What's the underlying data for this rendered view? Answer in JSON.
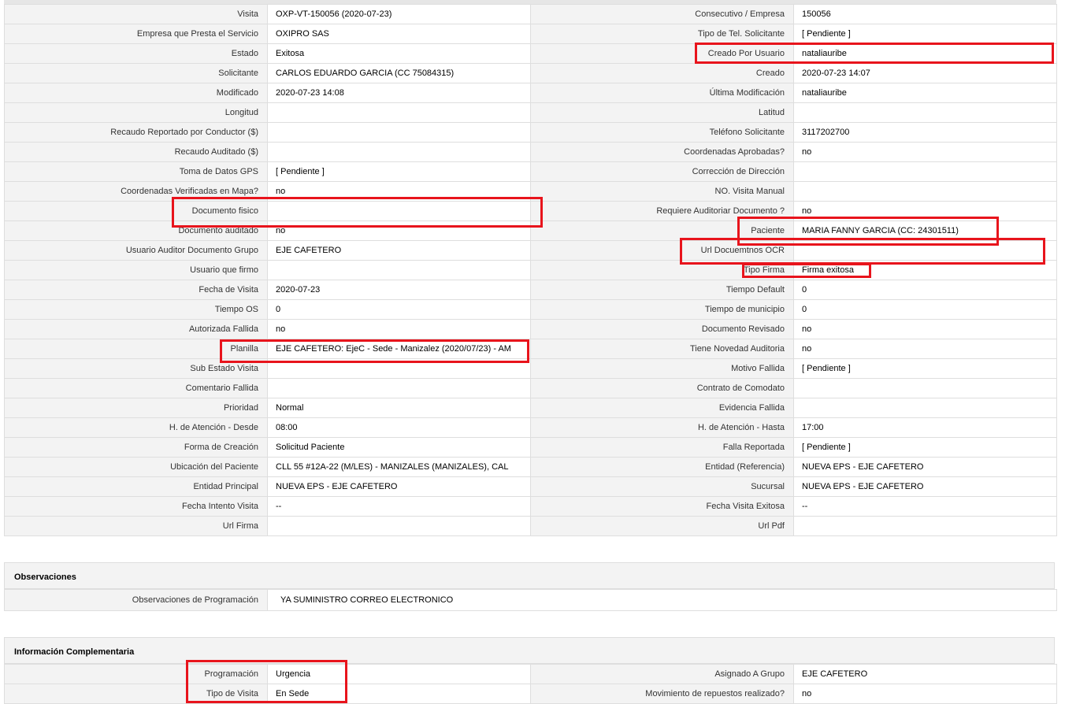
{
  "main": {
    "rows": [
      [
        {
          "label": "Visita",
          "value": "OXP-VT-150056 (2020-07-23)"
        },
        {
          "label": "Consecutivo / Empresa",
          "value": "150056"
        }
      ],
      [
        {
          "label": "Empresa que Presta el Servicio",
          "value": "OXIPRO SAS"
        },
        {
          "label": "Tipo de Tel. Solicitante",
          "value": "[ Pendiente ]"
        }
      ],
      [
        {
          "label": "Estado",
          "value": "Exitosa"
        },
        {
          "label": "Creado Por Usuario",
          "value": "nataliauribe"
        }
      ],
      [
        {
          "label": "Solicitante",
          "value": "CARLOS EDUARDO GARCIA (CC 75084315)"
        },
        {
          "label": "Creado",
          "value": "2020-07-23 14:07"
        }
      ],
      [
        {
          "label": "Modificado",
          "value": "2020-07-23 14:08"
        },
        {
          "label": "Última Modificación",
          "value": " nataliauribe"
        }
      ],
      [
        {
          "label": "Longitud",
          "value": ""
        },
        {
          "label": "Latitud",
          "value": ""
        }
      ],
      [
        {
          "label": "Recaudo Reportado por Conductor ($)",
          "value": ""
        },
        {
          "label": "Teléfono Solicitante",
          "value": "3117202700"
        }
      ],
      [
        {
          "label": "Recaudo Auditado ($)",
          "value": ""
        },
        {
          "label": "Coordenadas Aprobadas?",
          "value": " no"
        }
      ],
      [
        {
          "label": "Toma de Datos GPS",
          "value": "[ Pendiente ]"
        },
        {
          "label": "Corrección de Dirección",
          "value": ""
        }
      ],
      [
        {
          "label": "Coordenadas Verificadas en Mapa?",
          "value": " no"
        },
        {
          "label": "NO. Visita Manual",
          "value": ""
        }
      ],
      [
        {
          "label": "Documento fisico",
          "value": ""
        },
        {
          "label": "Requiere Auditoriar Documento ?",
          "value": " no"
        }
      ],
      [
        {
          "label": "Documento auditado",
          "value": " no"
        },
        {
          "label": "Paciente",
          "value": "MARIA FANNY GARCIA (CC: 24301511)"
        }
      ],
      [
        {
          "label": "Usuario Auditor Documento Grupo",
          "value": "EJE CAFETERO"
        },
        {
          "label": "Url Docuemtnos OCR",
          "value": ""
        }
      ],
      [
        {
          "label": "Usuario que firmo",
          "value": ""
        },
        {
          "label": "Tipo Firma",
          "value": "Firma exitosa"
        }
      ],
      [
        {
          "label": "Fecha de Visita",
          "value": " 2020-07-23"
        },
        {
          "label": "Tiempo Default",
          "value": "0"
        }
      ],
      [
        {
          "label": "Tiempo OS",
          "value": "0"
        },
        {
          "label": "Tiempo de municipio",
          "value": "0"
        }
      ],
      [
        {
          "label": "Autorizada Fallida",
          "value": " no"
        },
        {
          "label": "Documento Revisado",
          "value": " no"
        }
      ],
      [
        {
          "label": "Planilla",
          "value": "EJE CAFETERO: EjeC - Sede - Manizalez (2020/07/23) - AM"
        },
        {
          "label": "Tiene Novedad Auditoria",
          "value": " no"
        }
      ],
      [
        {
          "label": "Sub Estado Visita",
          "value": ""
        },
        {
          "label": "Motivo Fallida",
          "value": "[ Pendiente ]"
        }
      ],
      [
        {
          "label": "Comentario Fallida",
          "value": ""
        },
        {
          "label": "Contrato de Comodato",
          "value": ""
        }
      ],
      [
        {
          "label": "Prioridad",
          "value": "Normal"
        },
        {
          "label": "Evidencia Fallida",
          "value": ""
        }
      ],
      [
        {
          "label": "H. de Atención - Desde",
          "value": "08:00"
        },
        {
          "label": "H. de Atención - Hasta",
          "value": "17:00"
        }
      ],
      [
        {
          "label": "Forma de Creación",
          "value": "Solicitud Paciente"
        },
        {
          "label": "Falla Reportada",
          "value": "[ Pendiente ]"
        }
      ],
      [
        {
          "label": "Ubicación del Paciente",
          "value": "CLL 55 #12A-22 (M/LES) - MANIZALES (MANIZALES), CAL"
        },
        {
          "label": "Entidad (Referencia)",
          "value": "NUEVA EPS - EJE CAFETERO"
        }
      ],
      [
        {
          "label": "Entidad Principal",
          "value": "NUEVA EPS - EJE CAFETERO"
        },
        {
          "label": "Sucursal",
          "value": "NUEVA EPS - EJE CAFETERO"
        }
      ],
      [
        {
          "label": "Fecha Intento Visita",
          "value": "--"
        },
        {
          "label": "Fecha Visita Exitosa",
          "value": " --"
        }
      ],
      [
        {
          "label": "Url Firma",
          "value": ""
        },
        {
          "label": "Url Pdf",
          "value": ""
        }
      ]
    ]
  },
  "observaciones": {
    "title": "Observaciones",
    "label": "Observaciones de Programación",
    "value": " YA SUMINISTRO CORREO ELECTRONICO"
  },
  "complementaria": {
    "title": "Información Complementaria",
    "rows": [
      [
        {
          "label": "Programación",
          "value": "Urgencia"
        },
        {
          "label": "Asignado A Grupo",
          "value": "EJE CAFETERO"
        }
      ],
      [
        {
          "label": "Tipo de Visita",
          "value": "En Sede"
        },
        {
          "label": "Movimiento de repuestos realizado?",
          "value": " no"
        }
      ]
    ]
  },
  "colors": {
    "highlight": "#e8141c",
    "label_bg": "#f3f3f3",
    "border": "#dedede"
  }
}
